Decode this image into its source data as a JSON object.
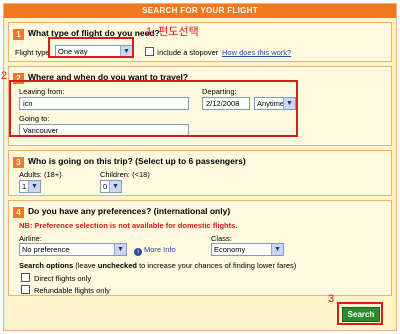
{
  "header": {
    "title": "SEARCH FOR YOUR FLIGHT"
  },
  "annotations": {
    "step1": "1. 편도선택",
    "step2": "2",
    "step3": "3"
  },
  "section1": {
    "number": "1",
    "title": "What type of flight do you need?",
    "flight_type_label": "Flight type",
    "flight_type_value": "One way",
    "stopover_label": "Include a stopover",
    "how_link": "How does this work?"
  },
  "section2": {
    "number": "2",
    "title": "Where and when do you want to travel?",
    "leaving_label": "Leaving from:",
    "leaving_value": "icn",
    "departing_label": "Departing:",
    "departing_value": "2/12/2008",
    "time_value": "Anytime",
    "going_label": "Going to:",
    "going_value": "Vancouver"
  },
  "section3": {
    "number": "3",
    "title": "Who is going on this trip? (Select up to 6 passengers)",
    "adults_label": "Adults: (18+)",
    "adults_value": "1",
    "children_label": "Children: (<18)",
    "children_value": "0"
  },
  "section4": {
    "number": "4",
    "title": "Do you have any preferences? (international only)",
    "note": "NB: Preference selection is not available for domestic flights.",
    "airline_label": "Airline:",
    "airline_value": "No preference",
    "more_info": "More Info",
    "class_label": "Class:",
    "class_value": "Economy",
    "search_options_bold": "Search options",
    "search_options_rest1": " (leave ",
    "search_options_unchecked": "unchecked",
    "search_options_rest2": " to increase your chances of finding lower fares)",
    "direct_label": "Direct flights only",
    "refundable_label": "Refundable flights only"
  },
  "search_button": {
    "label": "Search"
  },
  "colors": {
    "accent": "#f07820",
    "annotation": "#d81b1b",
    "button": "#2e8b2e"
  }
}
